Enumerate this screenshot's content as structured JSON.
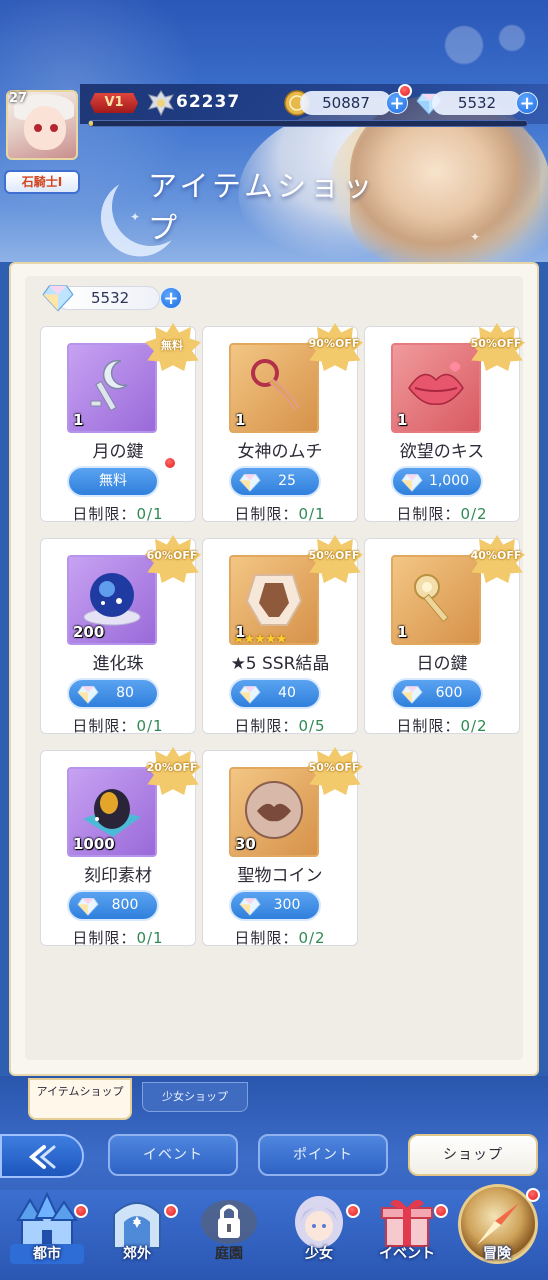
{
  "header": {
    "avatar_level": "27",
    "rank_badge": "石騎士Ⅰ",
    "vip_label": "V1",
    "power_value": "62237",
    "exp_progress": 0.01,
    "gold_amount": "50887",
    "gems_amount": "5532",
    "shop_title": "アイテムショップ"
  },
  "balance": {
    "gems": "5532"
  },
  "items": [
    {
      "name": "月の鍵",
      "qty": "1",
      "discount": "無料",
      "price": "無料",
      "limit_label": "日制限：",
      "limit_value": "0/1",
      "price_is_gem": false,
      "icon": "moon-key-icon",
      "has_notice": true
    },
    {
      "name": "女神のムチ",
      "qty": "1",
      "discount": "90%OFF",
      "price": "25",
      "limit_label": "日制限：",
      "limit_value": "0/1",
      "price_is_gem": true,
      "icon": "goddess-whip-icon",
      "has_notice": false
    },
    {
      "name": "欲望のキス",
      "qty": "1",
      "discount": "50%OFF",
      "price": "1,000",
      "limit_label": "日制限：",
      "limit_value": "0/2",
      "price_is_gem": true,
      "icon": "desire-kiss-icon",
      "has_notice": false
    },
    {
      "name": "進化珠",
      "qty": "200",
      "discount": "60%OFF",
      "price": "80",
      "limit_label": "日制限：",
      "limit_value": "0/1",
      "price_is_gem": true,
      "icon": "evolution-orb-icon",
      "has_notice": false
    },
    {
      "name": "★5 SSR結晶",
      "qty": "1",
      "discount": "50%OFF",
      "price": "40",
      "limit_label": "日制限：",
      "limit_value": "0/5",
      "price_is_gem": true,
      "icon": "ssr-crystal-icon",
      "has_notice": false,
      "stars": "★★★★★"
    },
    {
      "name": "日の鍵",
      "qty": "1",
      "discount": "40%OFF",
      "price": "600",
      "limit_label": "日制限：",
      "limit_value": "0/2",
      "price_is_gem": true,
      "icon": "sun-key-icon",
      "has_notice": false
    },
    {
      "name": "刻印素材",
      "qty": "1000",
      "discount": "20%OFF",
      "price": "800",
      "limit_label": "日制限：",
      "limit_value": "0/1",
      "price_is_gem": true,
      "icon": "engraving-material-icon",
      "has_notice": false
    },
    {
      "name": "聖物コイン",
      "qty": "30",
      "discount": "50%OFF",
      "price": "300",
      "limit_label": "日制限：",
      "limit_value": "0/2",
      "price_is_gem": true,
      "icon": "relic-coin-icon",
      "has_notice": false
    }
  ],
  "subtabs": [
    {
      "label": "アイテムショップ",
      "active": true
    },
    {
      "label": "少女ショップ",
      "active": false
    }
  ],
  "mode_tabs": [
    {
      "label": "イベント",
      "active": false
    },
    {
      "label": "ポイント",
      "active": false
    },
    {
      "label": "ショップ",
      "active": true
    }
  ],
  "navbar": [
    {
      "label": "都市",
      "icon": "castle-icon",
      "has_notice": true
    },
    {
      "label": "郊外",
      "icon": "gate-icon",
      "has_notice": true
    },
    {
      "label": "庭園",
      "icon": "lock-icon",
      "has_notice": false
    },
    {
      "label": "少女",
      "icon": "girl-portrait-icon",
      "has_notice": true
    },
    {
      "label": "イベント",
      "icon": "gift-box-icon",
      "has_notice": true
    },
    {
      "label": "冒険",
      "icon": "compass-icon",
      "has_notice": true
    }
  ],
  "colors": {
    "accent_blue": "#2f7fdc",
    "limit_green": "#2f8a54",
    "badge_gold": "#f2c96b",
    "notice_red": "#e41d1d"
  }
}
